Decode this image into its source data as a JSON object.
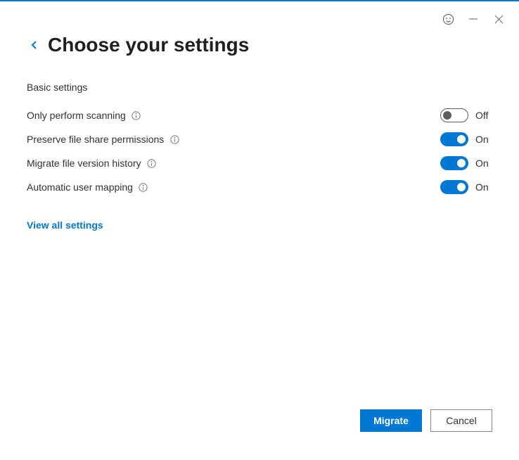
{
  "header": {
    "title": "Choose your settings"
  },
  "section_label": "Basic settings",
  "states": {
    "on": "On",
    "off": "Off"
  },
  "settings": {
    "scanning": {
      "label": "Only perform scanning",
      "enabled": false
    },
    "permissions": {
      "label": "Preserve file share permissions",
      "enabled": true
    },
    "version_history": {
      "label": "Migrate file version history",
      "enabled": true
    },
    "user_mapping": {
      "label": "Automatic user mapping",
      "enabled": true
    }
  },
  "links": {
    "view_all": "View all settings"
  },
  "buttons": {
    "migrate": "Migrate",
    "cancel": "Cancel"
  }
}
